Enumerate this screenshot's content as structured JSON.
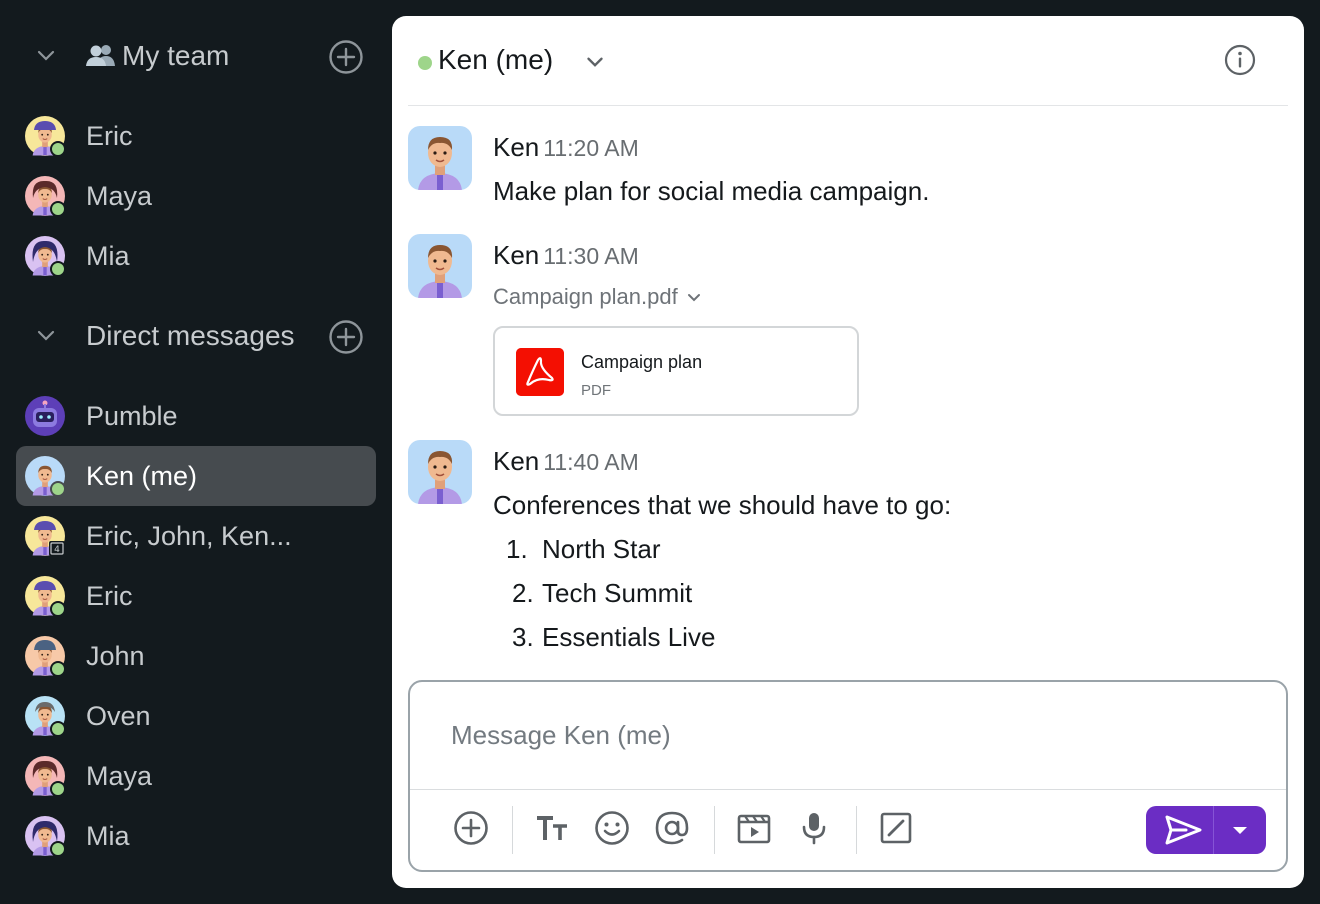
{
  "sidebar": {
    "team_section": {
      "title": "My team"
    },
    "team_members": [
      {
        "name": "Eric",
        "avatar": "avatar-eric",
        "status": "online"
      },
      {
        "name": "Maya",
        "avatar": "avatar-maya",
        "status": "online"
      },
      {
        "name": "Mia",
        "avatar": "avatar-mia",
        "status": "online"
      }
    ],
    "dm_section": {
      "title": "Direct messages"
    },
    "direct_messages": [
      {
        "name": "Pumble",
        "avatar": "bot-avatar"
      },
      {
        "name": "Ken (me)",
        "avatar": "avatar-ken",
        "status": "online",
        "active": true
      },
      {
        "name": "Eric, John, Ken...",
        "avatar": "group-avatar",
        "badge": "4"
      },
      {
        "name": "Eric",
        "avatar": "avatar-eric",
        "status": "online"
      },
      {
        "name": "John",
        "avatar": "avatar-john",
        "status": "online"
      },
      {
        "name": "Oven",
        "avatar": "avatar-oven",
        "status": "online"
      },
      {
        "name": "Maya",
        "avatar": "avatar-maya",
        "status": "online"
      },
      {
        "name": "Mia",
        "avatar": "avatar-mia",
        "status": "online"
      }
    ]
  },
  "channel": {
    "title": "Ken (me)",
    "status": "online"
  },
  "messages": [
    {
      "author": "Ken",
      "time": "11:20 AM",
      "text": "Make plan for social media campaign."
    },
    {
      "author": "Ken",
      "time": "11:30 AM",
      "file_toggle": "Campaign plan.pdf",
      "file": {
        "title": "Campaign plan",
        "type": "PDF"
      }
    },
    {
      "author": "Ken",
      "time": "11:40 AM",
      "text": "Conferences that we should have to go:",
      "list": [
        {
          "num": "1.",
          "text": "North Star"
        },
        {
          "num": "2.",
          "text": "Tech Summit"
        },
        {
          "num": "3.",
          "text": "Essentials Live"
        }
      ]
    }
  ],
  "composer": {
    "placeholder": "Message Ken (me)",
    "toolbar_icons": [
      "add-circle-icon",
      "text-format-icon",
      "emoji-icon",
      "mention-icon",
      "video-clip-icon",
      "microphone-icon",
      "slash-command-icon"
    ],
    "send_icon": "send-icon"
  },
  "colors": {
    "accent": "#6b2dc4",
    "online": "#9ed58a",
    "sidebar_bg": "#131a1e",
    "active_item": "#464b4f",
    "pdf_red": "#f40f02"
  }
}
